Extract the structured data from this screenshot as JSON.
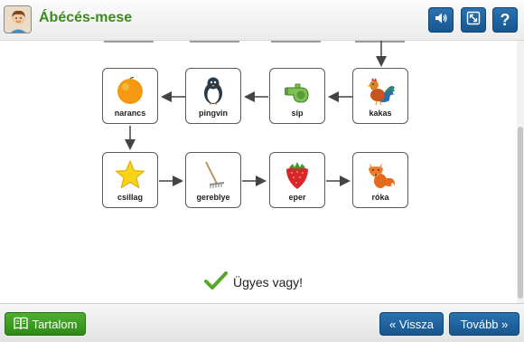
{
  "header": {
    "title": "Ábécés-mese"
  },
  "words": {
    "narancs": "narancs",
    "pingvin": "pingvin",
    "sip": "síp",
    "kakas": "kakas",
    "csillag": "csillag",
    "gereblye": "gereblye",
    "eper": "eper",
    "roka": "róka"
  },
  "feedback": {
    "text": "Ügyes vagy!"
  },
  "footer": {
    "contents_label": "Tartalom",
    "back_label": "« Vissza",
    "next_label": "Tovább »"
  },
  "colors": {
    "accent_green": "#3d8a1e",
    "button_blue": "#1f66a3",
    "button_green": "#3b9a22",
    "check_green": "#58a62b"
  }
}
